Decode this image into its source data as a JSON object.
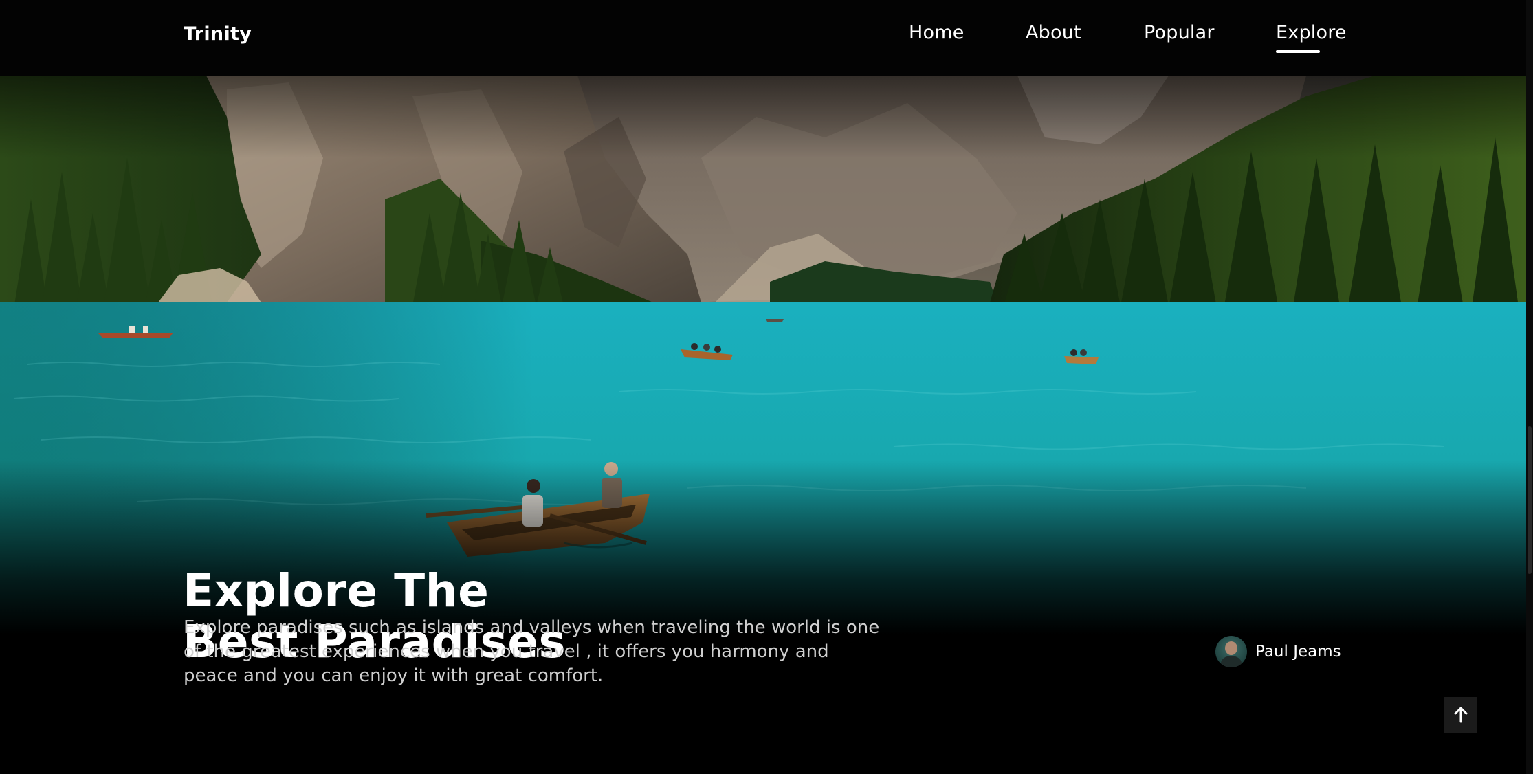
{
  "header": {
    "logo": "Trinity",
    "nav": [
      {
        "label": "Home"
      },
      {
        "label": "About"
      },
      {
        "label": "Popular"
      },
      {
        "label": "Explore",
        "active": true
      }
    ]
  },
  "hero": {
    "title_line1": "Explore The",
    "title_line2": "Best Paradises",
    "description": "Explore paradises such as islands and valleys when traveling the world is one of the greatest experiences when you travel , it offers you harmony and peace and you can enjoy it with great comfort.",
    "author": {
      "name": "Paul Jeams",
      "icon": "avatar"
    },
    "scroll_top_icon": "arrow-up-icon"
  },
  "colors": {
    "background": "#000000",
    "lake": "#1aa7b0",
    "forest": "#1f3a14",
    "text_muted": "#cfcfcf"
  }
}
